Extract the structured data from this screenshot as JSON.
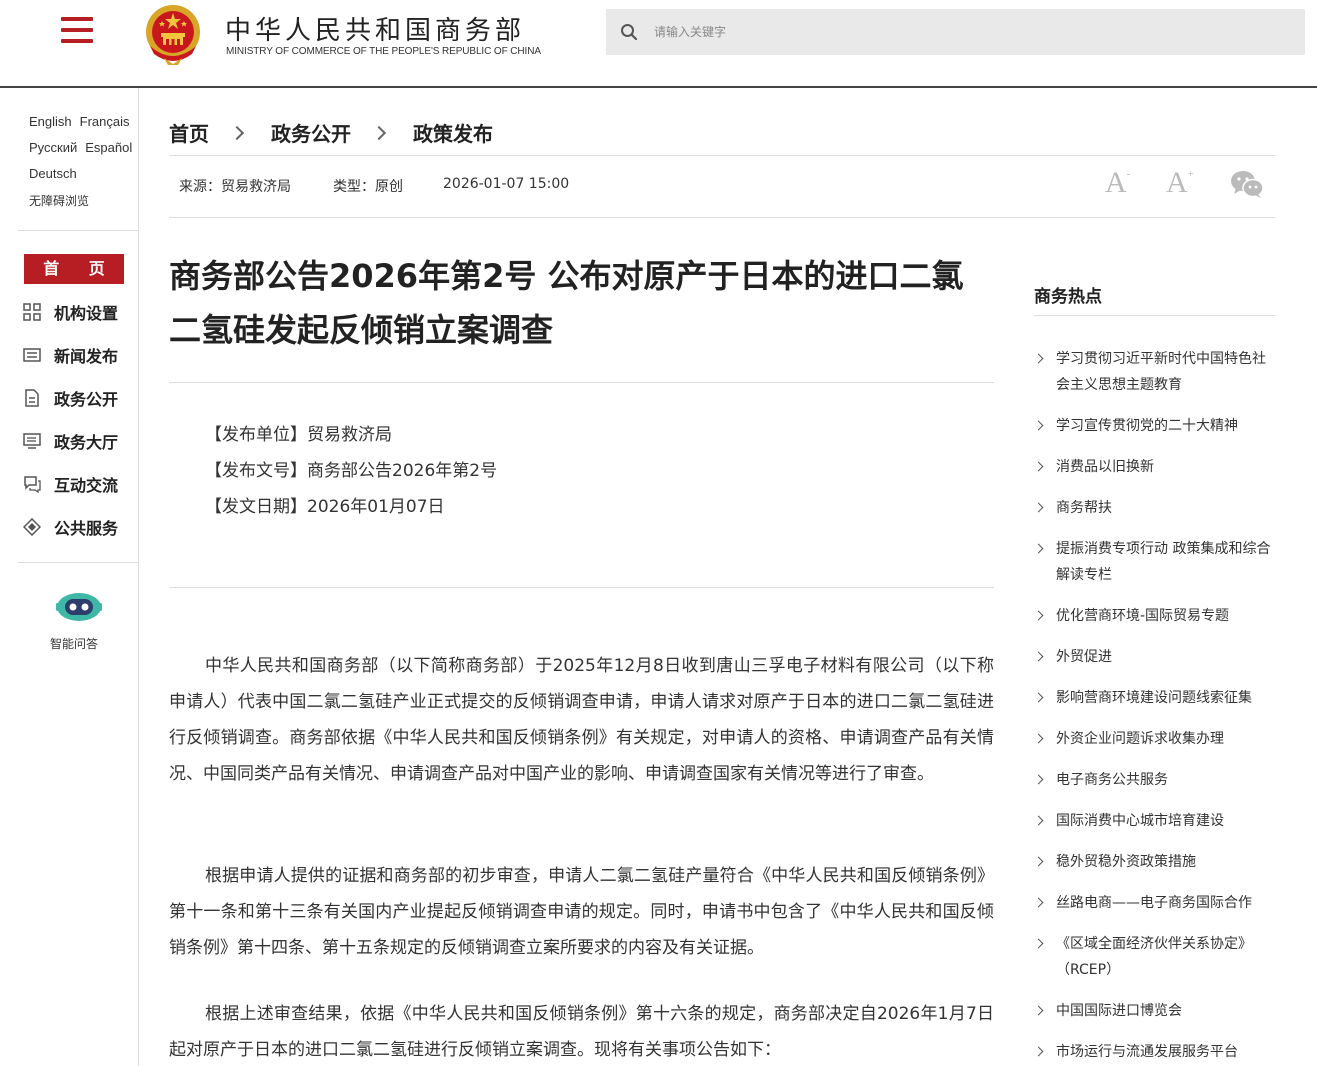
{
  "header": {
    "title_cn": "中华人民共和国商务部",
    "title_en": "MINISTRY OF COMMERCE OF THE PEOPLE'S REPUBLIC OF CHINA",
    "search_placeholder": "请输入关键字",
    "brand_color": "#b71e23"
  },
  "sidebar": {
    "languages": [
      "English",
      "Français",
      "Русский",
      "Español",
      "Deutsch"
    ],
    "accessibility": "无障碍浏览",
    "home": "首 页",
    "items": [
      {
        "label": "机构设置",
        "icon": "grid-icon"
      },
      {
        "label": "新闻发布",
        "icon": "news-icon"
      },
      {
        "label": "政务公开",
        "icon": "document-icon"
      },
      {
        "label": "政务大厅",
        "icon": "monitor-icon"
      },
      {
        "label": "互动交流",
        "icon": "chat-icon"
      },
      {
        "label": "公共服务",
        "icon": "service-icon"
      }
    ],
    "assistant": "智能问答"
  },
  "breadcrumb": [
    "首页",
    "政务公开",
    "政策发布"
  ],
  "meta": {
    "source": "来源：贸易救济局",
    "type": "类型：原创",
    "datetime": "2026-01-07 15:00",
    "font_small": "A",
    "font_large": "A",
    "minus": "-",
    "plus": "+"
  },
  "article": {
    "title": "商务部公告2026年第2号 公布对原产于日本的进口二氯二氢硅发起反倾销立案调查",
    "info": [
      "【发布单位】贸易救济局",
      "【发布文号】商务部公告2026年第2号",
      "【发文日期】2026年01月07日"
    ],
    "paragraphs": [
      "中华人民共和国商务部（以下简称商务部）于2025年12月8日收到唐山三孚电子材料有限公司（以下称申请人）代表中国二氯二氢硅产业正式提交的反倾销调查申请，申请人请求对原产于日本的进口二氯二氢硅进行反倾销调查。商务部依据《中华人民共和国反倾销条例》有关规定，对申请人的资格、申请调查产品有关情况、中国同类产品有关情况、申请调查产品对中国产业的影响、申请调查国家有关情况等进行了审查。",
      "根据申请人提供的证据和商务部的初步审查，申请人二氯二氢硅产量符合《中华人民共和国反倾销条例》第十一条和第十三条有关国内产业提起反倾销调查申请的规定。同时，申请书中包含了《中华人民共和国反倾销条例》第十四条、第十五条规定的反倾销调查立案所要求的内容及有关证据。",
      "根据上述审查结果，依据《中华人民共和国反倾销条例》第十六条的规定，商务部决定自2026年1月7日起对原产于日本的进口二氯二氢硅进行反倾销立案调查。现将有关事项公告如下："
    ]
  },
  "hot": {
    "title": "商务热点",
    "items": [
      "学习贯彻习近平新时代中国特色社会主义思想主题教育",
      "学习宣传贯彻党的二十大精神",
      "消费品以旧换新",
      "商务帮扶",
      "提振消费专项行动 政策集成和综合解读专栏",
      "优化营商环境-国际贸易专题",
      "外贸促进",
      "影响营商环境建设问题线索征集",
      "外资企业问题诉求收集办理",
      "电子商务公共服务",
      "国际消费中心城市培育建设",
      "稳外贸稳外资政策措施",
      "丝路电商——电子商务国际合作",
      "《区域全面经济伙伴关系协定》（RCEP）",
      "中国国际进口博览会",
      "市场运行与流通发展服务平台"
    ]
  }
}
